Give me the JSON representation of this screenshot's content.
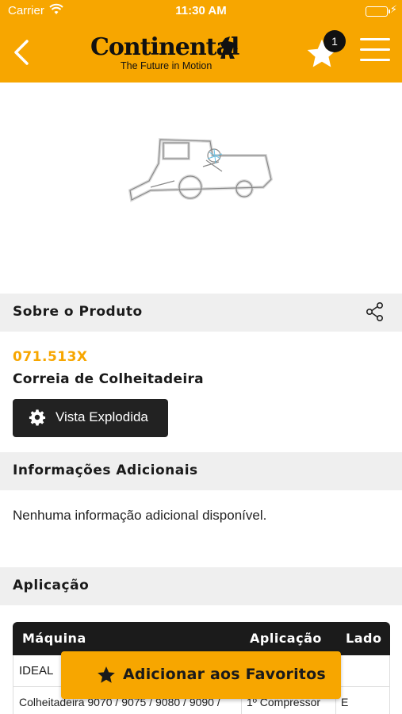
{
  "status_bar": {
    "carrier": "Carrier",
    "time": "11:30 AM",
    "wifi_icon": "wifi-icon",
    "battery_icon": "battery-icon"
  },
  "nav": {
    "back_icon": "chevron-left-icon",
    "logo_text": "Continental",
    "logo_tagline": "The Future in Motion",
    "favorites_badge": "1",
    "menu_icon": "hamburger-menu-icon"
  },
  "about": {
    "title": "Sobre o Produto",
    "share_icon": "share-icon",
    "sku": "071.513X",
    "name": "Correia de Colheitadeira",
    "exploded_view_label": "Vista Explodida"
  },
  "additional": {
    "title": "Informações Adicionais",
    "text": "Nenhuma informação adicional disponível."
  },
  "application": {
    "title": "Aplicação",
    "columns": [
      "Máquina",
      "Aplicação",
      "Lado"
    ],
    "groups": [
      {
        "brand": "IDEAL",
        "rows": [
          {
            "machine": "Colheitadeira 9070 / 9075 / 9080 / 9090 /",
            "application": "1º Compressor",
            "side": "E"
          }
        ]
      }
    ]
  },
  "add_favorites_label": "Adicionar aos Favoritos",
  "colors": {
    "brand_orange": "#f7a600",
    "dark": "#1b1b1b",
    "section_bg": "#efefef"
  }
}
